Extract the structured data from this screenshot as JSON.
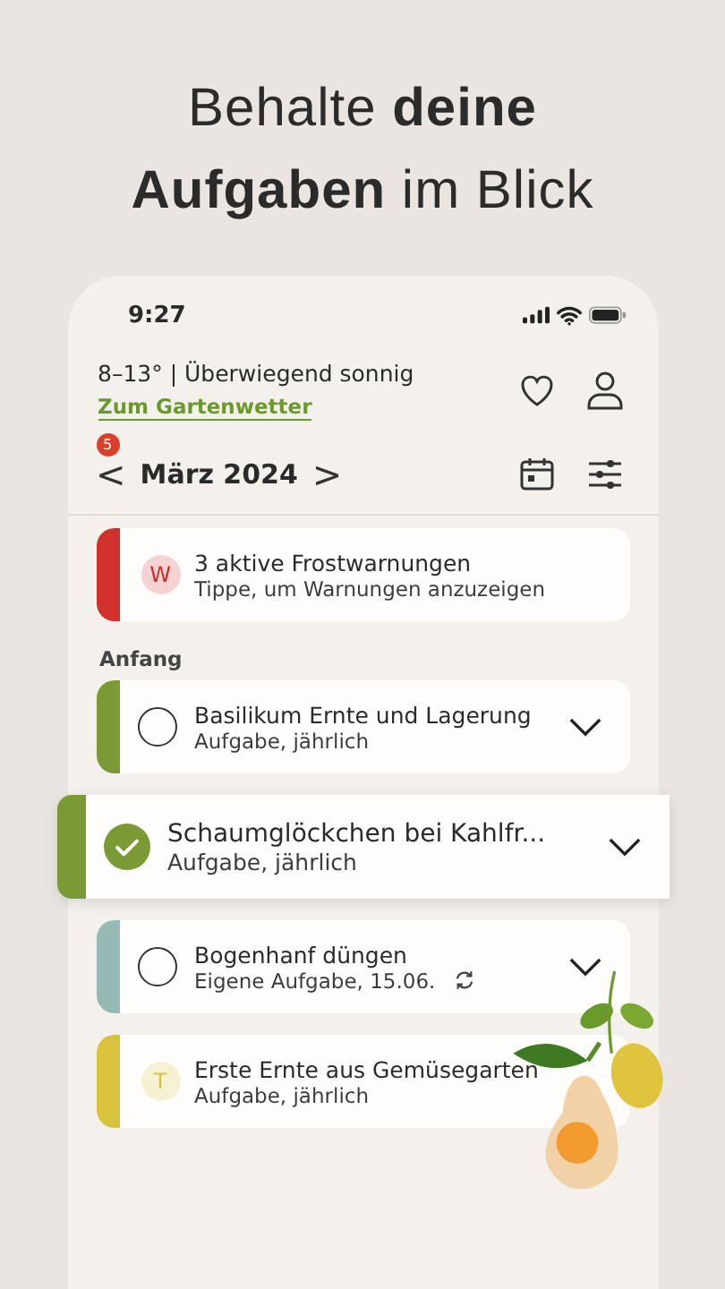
{
  "headline": "Behalte **deine** **Aufgaben** im Blick",
  "status_bar": {
    "time": "9:27"
  },
  "weather": {
    "summary": "8–13° | Überwiegend sonnig",
    "link": "Zum Gartenwetter"
  },
  "month_nav": {
    "prev": "<",
    "label": "März 2024",
    "next": ">",
    "badge": "5"
  },
  "warning": {
    "color": "#d0312d",
    "letter": "W",
    "title": "3 aktive Frostwarnungen",
    "subtitle": "Tippe, um Warnungen anzuzeigen"
  },
  "section": "Anfang",
  "tasks": [
    {
      "kind": "checkbox",
      "color": "#7a9a35",
      "checked": false,
      "lifted": false,
      "title": "Basilikum Ernte und Lagerung",
      "subtitle": "Aufgabe, jährlich",
      "repeat": false,
      "expandable": true
    },
    {
      "kind": "checkbox",
      "color": "#7a9a35",
      "checked": true,
      "lifted": true,
      "title": "Schaumglöckchen bei Kahlfr...",
      "subtitle": "Aufgabe, jährlich",
      "repeat": false,
      "expandable": true
    },
    {
      "kind": "checkbox",
      "color": "#95bab6",
      "checked": false,
      "lifted": false,
      "title": "Bogenhanf düngen",
      "subtitle": "Eigene Aufgabe, 15.06.",
      "repeat": true,
      "expandable": true
    },
    {
      "kind": "letter",
      "letter": "T",
      "color": "#d9c23c",
      "lifted": false,
      "title": "Erste Ernte aus Gemüsegarten",
      "subtitle": "Aufgabe, jährlich",
      "repeat": false,
      "expandable": false
    }
  ]
}
